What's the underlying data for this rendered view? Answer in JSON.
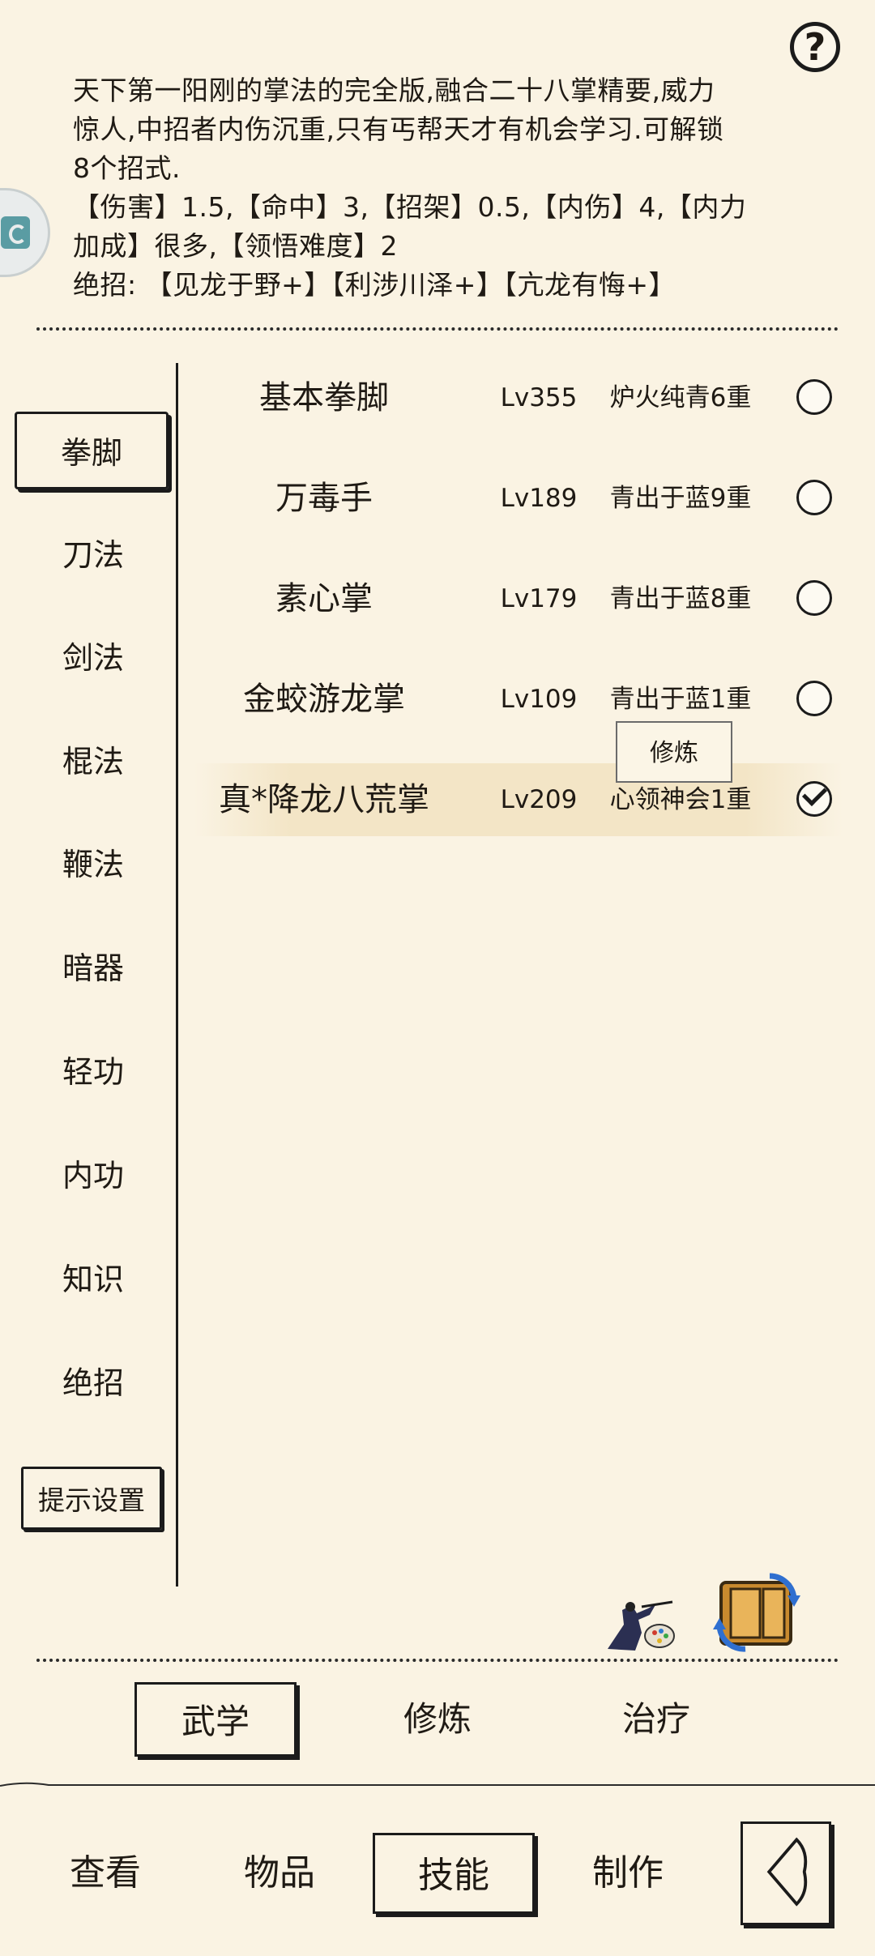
{
  "help": {
    "label": "?"
  },
  "description": {
    "line1": "天下第一阳刚的掌法的完全版,融合二十八掌精要,威力",
    "line2": "惊人,中招者内伤沉重,只有丐帮天才有机会学习.可解锁",
    "line3": "8个招式.",
    "stats_line1": "【伤害】1.5,【命中】3,【招架】0.5,【内伤】4,【内力",
    "stats_line2": "加成】很多,【领悟难度】2",
    "ultimates": "绝招: 【见龙于野+】【利涉川泽+】【亢龙有悔+】"
  },
  "sidebar": {
    "items": [
      {
        "label": "拳脚",
        "active": true
      },
      {
        "label": "刀法"
      },
      {
        "label": "剑法"
      },
      {
        "label": "棍法"
      },
      {
        "label": "鞭法"
      },
      {
        "label": "暗器"
      },
      {
        "label": "轻功"
      },
      {
        "label": "内功"
      },
      {
        "label": "知识"
      },
      {
        "label": "绝招"
      }
    ],
    "hint_settings": "提示设置"
  },
  "skills": [
    {
      "name": "基本拳脚",
      "level": "Lv355",
      "realm": "炉火纯青6重",
      "equipped": false
    },
    {
      "name": "万毒手",
      "level": "Lv189",
      "realm": "青出于蓝9重",
      "equipped": false
    },
    {
      "name": "素心掌",
      "level": "Lv179",
      "realm": "青出于蓝8重",
      "equipped": false
    },
    {
      "name": "金蛟游龙掌",
      "level": "Lv109",
      "realm": "青出于蓝1重",
      "equipped": false
    },
    {
      "name": "真*降龙八荒掌",
      "level": "Lv209",
      "realm": "心领神会1重",
      "equipped": true
    }
  ],
  "train_popup": "修炼",
  "subtabs": [
    {
      "label": "武学",
      "active": true
    },
    {
      "label": "修炼"
    },
    {
      "label": "治疗"
    }
  ],
  "nav": [
    {
      "label": "查看"
    },
    {
      "label": "物品"
    },
    {
      "label": "技能",
      "active": true
    },
    {
      "label": "制作"
    }
  ]
}
